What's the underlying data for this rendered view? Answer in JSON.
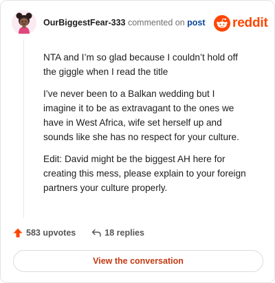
{
  "comment": {
    "username": "OurBiggestFear-333",
    "action_text": "commented on",
    "post_link": "post",
    "paragraphs": [
      "NTA and I’m so glad because I couldn’t hold off the giggle when I read the title",
      "I’ve never been to a Balkan wedding but I imagine it to be as extravagant to the ones we have in West Africa, wife set herself up and sounds like she has no respect for your culture.",
      "Edit: David might be the biggest AH here for creating this mess, please explain to your foreign partners your culture properly."
    ]
  },
  "brand": {
    "name": "reddit",
    "icon": "reddit-snoo-icon",
    "color": "#ff4500"
  },
  "stats": {
    "upvotes": "583 upvotes",
    "replies": "18 replies",
    "upvote_icon": "upvote-arrow-icon",
    "reply_icon": "reply-arrow-icon"
  },
  "cta": {
    "label": "View the conversation"
  },
  "colors": {
    "accent": "#ff4500",
    "link": "#0a449b",
    "cta_text": "#c23a10"
  }
}
